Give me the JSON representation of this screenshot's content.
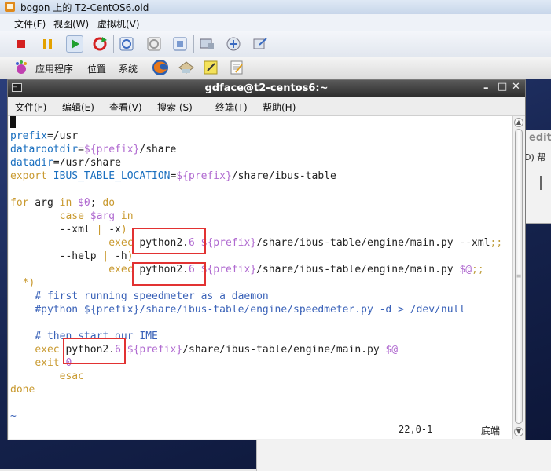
{
  "vm": {
    "title": "bogon 上的 T2-CentOS6.old",
    "menu": [
      "文件(F)",
      "视图(W)",
      "虚拟机(V)"
    ]
  },
  "guest": {
    "panel": [
      "应用程序",
      "位置",
      "系统"
    ],
    "right_window_title": "edit",
    "right_window_text": "D) 帮"
  },
  "terminal": {
    "title": "gdface@t2-centos6:~",
    "menu": [
      "文件(F)",
      "编辑(E)",
      "查看(V)",
      "搜索 (S)",
      "终端(T)",
      "帮助(H)"
    ],
    "code": [
      {
        "type": "cursor"
      },
      {
        "segments": [
          [
            "v",
            "prefix"
          ],
          [
            "",
            "=/usr"
          ]
        ]
      },
      {
        "segments": [
          [
            "v",
            "datarootdir"
          ],
          [
            "",
            "="
          ],
          [
            "s",
            "${prefix}"
          ],
          [
            "",
            "/share"
          ]
        ]
      },
      {
        "segments": [
          [
            "v",
            "datadir"
          ],
          [
            "",
            "=/usr/share"
          ]
        ]
      },
      {
        "segments": [
          [
            "k",
            "export "
          ],
          [
            "v",
            "IBUS_TABLE_LOCATION"
          ],
          [
            "",
            "="
          ],
          [
            "s",
            "${prefix}"
          ],
          [
            "",
            "/share/ibus-table"
          ]
        ]
      },
      {
        "segments": [
          [
            "",
            ""
          ]
        ]
      },
      {
        "segments": [
          [
            "k",
            "for"
          ],
          [
            "",
            " arg "
          ],
          [
            "k",
            "in"
          ],
          [
            "",
            " "
          ],
          [
            "s",
            "$0"
          ],
          [
            "",
            "; "
          ],
          [
            "k",
            "do"
          ]
        ]
      },
      {
        "segments": [
          [
            "",
            "        "
          ],
          [
            "k",
            "case"
          ],
          [
            "",
            " "
          ],
          [
            "s",
            "$arg"
          ],
          [
            "",
            " "
          ],
          [
            "k",
            "in"
          ]
        ]
      },
      {
        "segments": [
          [
            "",
            "        --xml "
          ],
          [
            "k",
            "|"
          ],
          [
            "",
            " -x"
          ],
          [
            "k",
            ")"
          ]
        ]
      },
      {
        "segments": [
          [
            "",
            "                "
          ],
          [
            "k",
            "exec"
          ],
          [
            "",
            " python2."
          ],
          [
            "s",
            "6"
          ],
          [
            "",
            " "
          ],
          [
            "s",
            "${prefix}"
          ],
          [
            "",
            "/share/ibus-table/engine/main.py --xml"
          ],
          [
            "d",
            ";;"
          ]
        ]
      },
      {
        "segments": [
          [
            "",
            "        --help "
          ],
          [
            "k",
            "|"
          ],
          [
            "",
            " -h"
          ],
          [
            "k",
            ")"
          ]
        ]
      },
      {
        "segments": [
          [
            "",
            "                "
          ],
          [
            "k",
            "exec"
          ],
          [
            "",
            " python2."
          ],
          [
            "s",
            "6"
          ],
          [
            "",
            " "
          ],
          [
            "s",
            "${prefix}"
          ],
          [
            "",
            "/share/ibus-table/engine/main.py "
          ],
          [
            "s",
            "$@"
          ],
          [
            "d",
            ";;"
          ]
        ]
      },
      {
        "segments": [
          [
            "",
            "  "
          ],
          [
            "k",
            "*)"
          ]
        ]
      },
      {
        "segments": [
          [
            "",
            "    "
          ],
          [
            "c",
            "# first running speedmeter as a daemon"
          ]
        ]
      },
      {
        "segments": [
          [
            "",
            "    "
          ],
          [
            "c",
            "#python ${prefix}/share/ibus-table/engine/speedmeter.py -d > /dev/null"
          ]
        ]
      },
      {
        "segments": [
          [
            "",
            ""
          ]
        ]
      },
      {
        "segments": [
          [
            "",
            "    "
          ],
          [
            "c",
            "# then start our IME"
          ]
        ]
      },
      {
        "segments": [
          [
            "",
            "    "
          ],
          [
            "k",
            "exec"
          ],
          [
            "",
            " python2."
          ],
          [
            "s",
            "6"
          ],
          [
            "",
            " "
          ],
          [
            "s",
            "${prefix}"
          ],
          [
            "",
            "/share/ibus-table/engine/main.py "
          ],
          [
            "s",
            "$@"
          ]
        ]
      },
      {
        "segments": [
          [
            "",
            "    "
          ],
          [
            "k",
            "exit"
          ],
          [
            "",
            " "
          ],
          [
            "s",
            "0"
          ]
        ]
      },
      {
        "segments": [
          [
            "",
            "        "
          ],
          [
            "k",
            "esac"
          ]
        ]
      },
      {
        "segments": [
          [
            "k",
            "done"
          ]
        ]
      },
      {
        "segments": [
          [
            "",
            ""
          ]
        ]
      },
      {
        "segments": [
          [
            "tilde",
            "~"
          ]
        ]
      }
    ],
    "status_position": "22,0-1",
    "status_scroll": "底端"
  }
}
